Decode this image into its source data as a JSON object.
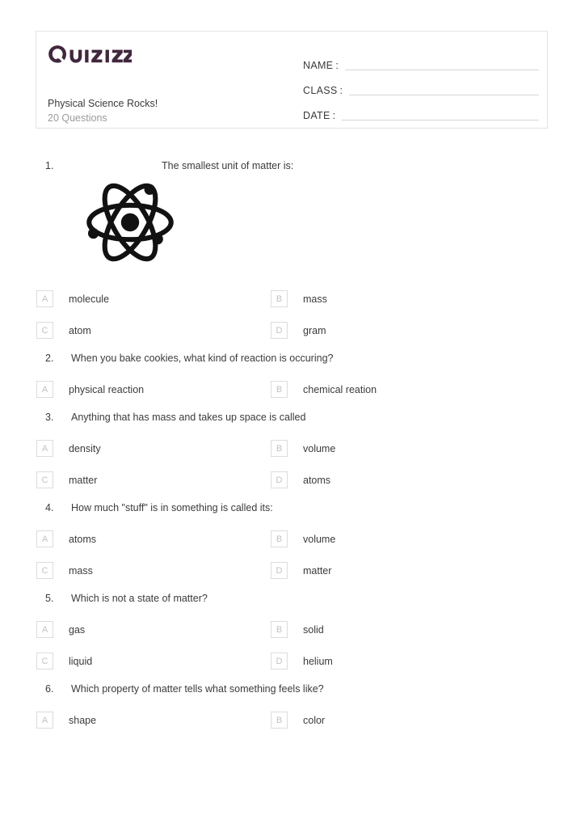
{
  "header": {
    "logo_text": "Quizizz",
    "logo_color": "#41263d",
    "quiz_title": "Physical Science Rocks!",
    "question_count_label": "20 Questions",
    "fields": [
      {
        "label": "NAME",
        "colon": ":",
        "value": ""
      },
      {
        "label": "CLASS",
        "colon": ":",
        "value": ""
      },
      {
        "label": "DATE",
        "colon": ":",
        "value": ""
      }
    ]
  },
  "questions": [
    {
      "number": "1.",
      "text": "The smallest unit of matter is:",
      "image": "atom-illustration",
      "options": [
        {
          "letter": "A",
          "text": "molecule"
        },
        {
          "letter": "B",
          "text": "mass"
        },
        {
          "letter": "C",
          "text": "atom"
        },
        {
          "letter": "D",
          "text": "gram"
        }
      ]
    },
    {
      "number": "2.",
      "text": "When you bake cookies, what kind of reaction is occuring?",
      "options": [
        {
          "letter": "A",
          "text": "physical reaction"
        },
        {
          "letter": "B",
          "text": "chemical reation"
        }
      ]
    },
    {
      "number": "3.",
      "text": "Anything that has mass and takes up space is called",
      "options": [
        {
          "letter": "A",
          "text": "density"
        },
        {
          "letter": "B",
          "text": "volume"
        },
        {
          "letter": "C",
          "text": "matter"
        },
        {
          "letter": "D",
          "text": "atoms"
        }
      ]
    },
    {
      "number": "4.",
      "text": "How much \"stuff\" is in something is called its:",
      "options": [
        {
          "letter": "A",
          "text": "atoms"
        },
        {
          "letter": "B",
          "text": "volume"
        },
        {
          "letter": "C",
          "text": "mass"
        },
        {
          "letter": "D",
          "text": "matter"
        }
      ]
    },
    {
      "number": "5.",
      "text": "Which is not a state of matter?",
      "options": [
        {
          "letter": "A",
          "text": "gas"
        },
        {
          "letter": "B",
          "text": "solid"
        },
        {
          "letter": "C",
          "text": "liquid"
        },
        {
          "letter": "D",
          "text": "helium"
        }
      ]
    },
    {
      "number": "6.",
      "text": "Which property of matter tells what something feels like?",
      "options": [
        {
          "letter": "A",
          "text": "shape"
        },
        {
          "letter": "B",
          "text": "color"
        }
      ]
    }
  ]
}
